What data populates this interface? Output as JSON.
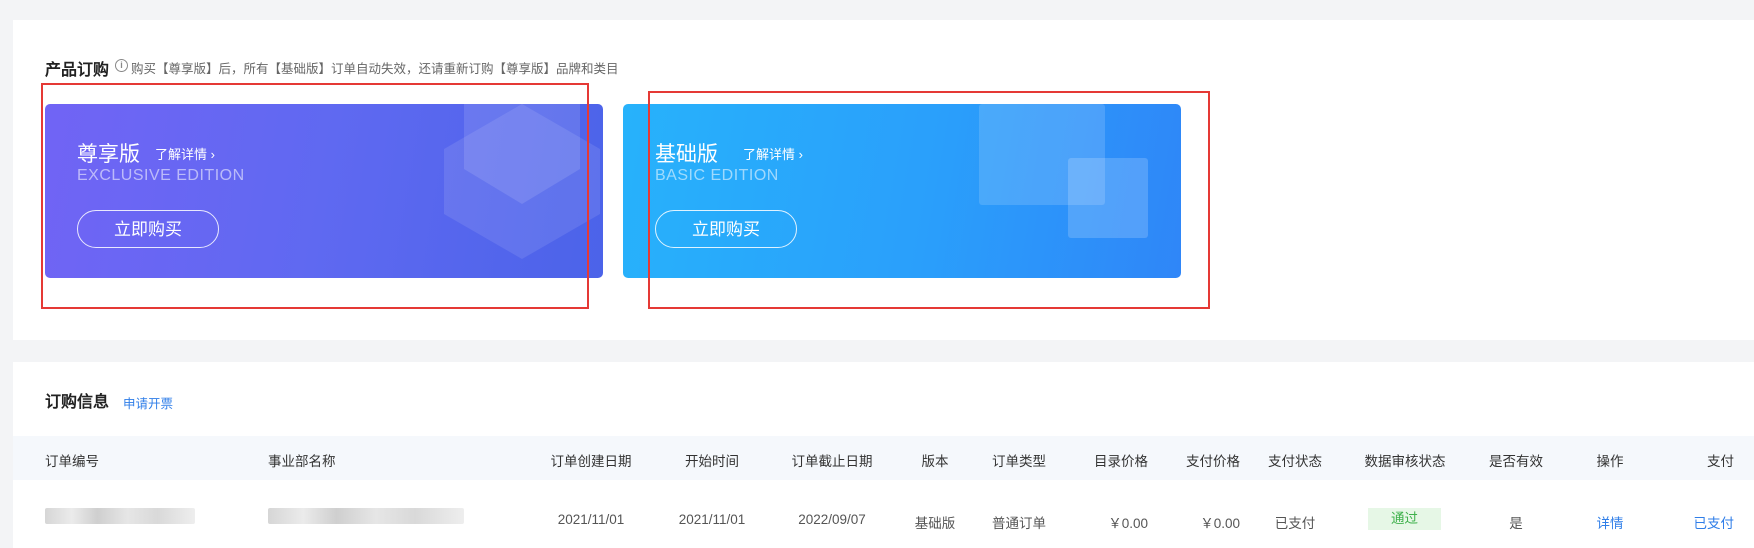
{
  "product_order": {
    "title": "产品订购",
    "note": "购买【尊享版】后，所有【基础版】订单自动失效，还请重新订购【尊享版】品牌和类目"
  },
  "cards": {
    "exclusive": {
      "name": "尊享版",
      "link": "了解详情 ›",
      "sub": "EXCLUSIVE EDITION",
      "button": "立即购买"
    },
    "basic": {
      "name": "基础版",
      "link": "了解详情 ›",
      "sub": "BASIC EDITION",
      "button": "立即购买"
    }
  },
  "order_info": {
    "title": "订购信息",
    "apply_link": "申请开票",
    "columns": [
      "订单编号",
      "事业部名称",
      "订单创建日期",
      "开始时间",
      "订单截止日期",
      "版本",
      "订单类型",
      "目录价格",
      "支付价格",
      "支付状态",
      "数据审核状态",
      "是否有效",
      "操作",
      "支付"
    ],
    "row": {
      "created": "2021/11/01",
      "start": "2021/11/01",
      "end": "2022/09/07",
      "version": "基础版",
      "type": "普通订单",
      "list_price": "￥0.00",
      "pay_price": "￥0.00",
      "pay_status": "已支付",
      "review_status": "通过",
      "valid": "是",
      "action": "详情",
      "pay": "已支付"
    }
  },
  "colors": {
    "exclusive_gradient": [
      "#7164f5",
      "#4b63e9"
    ],
    "basic_gradient": [
      "#27b2fb",
      "#2f86f8"
    ],
    "link_blue": "#2f7ee8",
    "highlight_red": "#e53935",
    "status_green": "#3fb14c"
  }
}
